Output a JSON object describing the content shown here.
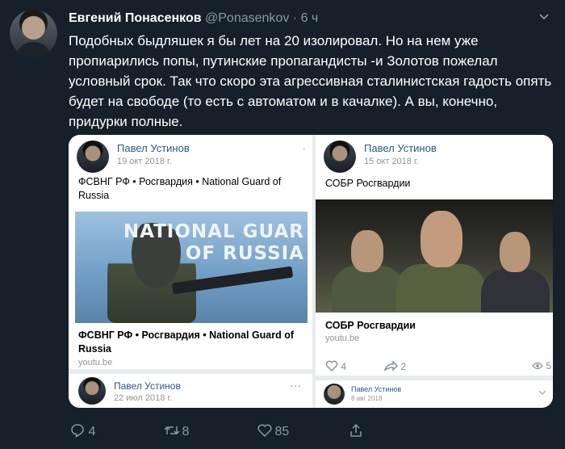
{
  "tweet": {
    "author_name": "Евгений Понасенков",
    "handle": "@Ponasenkov",
    "separator": "·",
    "time": "6 ч",
    "text": "Подобных быдляшек я бы лет на 20 изолировал. Но на нем уже пропиарились попы, путинские пропагандисты -и Золотов пожелал условный срок. Так что скоро эта агрессивная сталинистская гадость опять будет на свободе (то есть с автоматом и в качалке). А вы, конечно, придурки полные."
  },
  "left_post": {
    "author": "Павел Устинов",
    "date": "19 окт 2018 г.",
    "text": "ФСВНГ РФ • Росгвардия • National Guard of Russia",
    "thumb_title_line1": "NATIONAL GUAR",
    "thumb_title_line2": "OF RUSSIA",
    "link_title": "ФСВНГ РФ • Росгвардия • National Guard of Russia",
    "link_domain": "youtu.be",
    "next_author": "Павел Устинов",
    "next_date": "22 июл 2018 г.",
    "next_more": "···",
    "more": "·"
  },
  "right_post": {
    "author": "Павел Устинов",
    "date": "15 окт 2018 г.",
    "text": "СОБР Росгвардии",
    "link_title": "СОБР Росгвардии",
    "link_domain": "youtu.be",
    "likes": "4",
    "shares": "2",
    "views": "5",
    "next_author": "Павел Устинов",
    "next_date": "8 авг 2018"
  },
  "footer": {
    "replies": "4",
    "retweets": "8",
    "likes": "85"
  },
  "icons": [
    "chevron-down-icon",
    "reply-icon",
    "retweet-icon",
    "like-icon",
    "share-icon",
    "heart-outline-icon",
    "repost-arrow-icon",
    "eye-icon"
  ],
  "colors": {
    "background": "#15202b",
    "secondary_text": "#8899a6",
    "vk_link": "#2a5885"
  }
}
